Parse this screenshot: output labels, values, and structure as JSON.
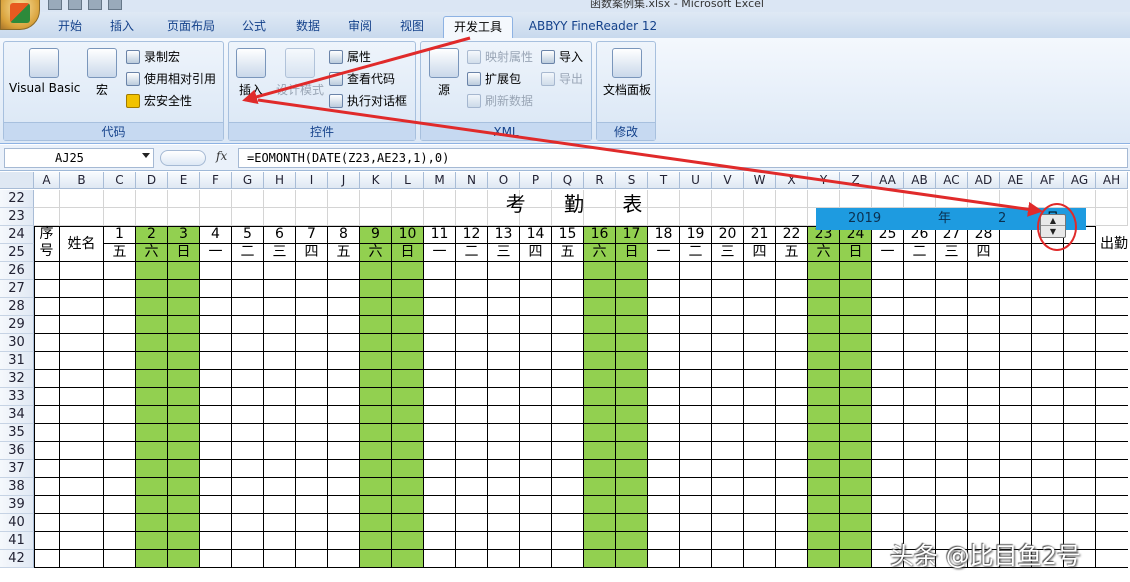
{
  "window": {
    "title": "函数案例集.xlsx - Microsoft Excel"
  },
  "tabs": [
    {
      "label": "开始"
    },
    {
      "label": "插入"
    },
    {
      "label": "页面布局"
    },
    {
      "label": "公式"
    },
    {
      "label": "数据"
    },
    {
      "label": "审阅"
    },
    {
      "label": "视图"
    },
    {
      "label": "开发工具",
      "active": true
    },
    {
      "label": "ABBYY FineReader 12"
    }
  ],
  "ribbon": {
    "code": {
      "label": "代码",
      "visual_basic": "Visual Basic",
      "macros": "宏",
      "record_macro": "录制宏",
      "relative_ref": "使用相对引用",
      "macro_security": "宏安全性"
    },
    "controls": {
      "label": "控件",
      "insert": "插入",
      "design_mode": "设计模式",
      "properties": "属性",
      "view_code": "查看代码",
      "run_dialog": "执行对话框"
    },
    "xml": {
      "label": "XML",
      "source": "源",
      "map_props": "映射属性",
      "expansion_packs": "扩展包",
      "refresh_data": "刷新数据",
      "import": "导入",
      "export": "导出"
    },
    "modify": {
      "label": "修改",
      "doc_panel": "文档面板"
    }
  },
  "formula_bar": {
    "name_box": "AJ25",
    "fx": "fx",
    "formula": "=EOMONTH(DATE(Z23,AE23,1),0)"
  },
  "columns": [
    "A",
    "B",
    "C",
    "D",
    "E",
    "F",
    "G",
    "H",
    "I",
    "J",
    "K",
    "L",
    "M",
    "N",
    "O",
    "P",
    "Q",
    "R",
    "S",
    "T",
    "U",
    "V",
    "W",
    "X",
    "Y",
    "Z",
    "AA",
    "AB",
    "AC",
    "AD",
    "AE",
    "AF",
    "AG",
    "AH"
  ],
  "rows": [
    "22",
    "23",
    "24",
    "25",
    "26",
    "27",
    "28",
    "29",
    "30",
    "31",
    "32",
    "33",
    "34",
    "35",
    "36",
    "37",
    "38",
    "39",
    "40",
    "41",
    "42"
  ],
  "sheet": {
    "title": "考 勤 表",
    "year": "2019",
    "year_label": "年",
    "month": "2",
    "month_label": "月",
    "header_seq": "序号",
    "header_name": "姓名",
    "header_right": "出勤",
    "days": [
      "1",
      "2",
      "3",
      "4",
      "5",
      "6",
      "7",
      "8",
      "9",
      "10",
      "11",
      "12",
      "13",
      "14",
      "15",
      "16",
      "17",
      "18",
      "19",
      "20",
      "21",
      "22",
      "23",
      "24",
      "25",
      "26",
      "27",
      "28"
    ],
    "weekdays": [
      "五",
      "六",
      "日",
      "一",
      "二",
      "三",
      "四",
      "五",
      "六",
      "日",
      "一",
      "二",
      "三",
      "四",
      "五",
      "六",
      "日",
      "一",
      "二",
      "三",
      "四",
      "五",
      "六",
      "日",
      "一",
      "二",
      "三",
      "四"
    ],
    "weekend_color": "#92d050",
    "header_bar_color": "#1e9be0"
  },
  "annotation": {
    "arrow_color": "#e02a2a"
  },
  "watermark": "头条 @比目鱼2号"
}
